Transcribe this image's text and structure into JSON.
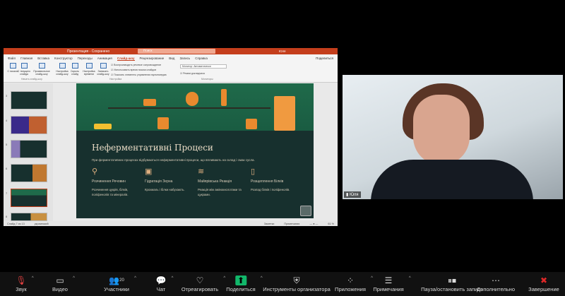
{
  "powerpoint": {
    "doc_title": "Презентация - Сохранено",
    "search_placeholder": "Поиск",
    "user": "Юля",
    "tabs": [
      "Файл",
      "Главная",
      "Вставка",
      "Конструктор",
      "Переходы",
      "Анимация",
      "Слайд-шоу",
      "Рецензирование",
      "Вид",
      "Запись",
      "Справка"
    ],
    "active_tab": "Слайд-шоу",
    "share": "Поделиться",
    "ribbon_buttons": [
      "С начала",
      "С текущего слайда",
      "Произвольное слайд-шоу",
      "Настройка слайд-шоу",
      "Скрыть слайд",
      "Настройка времени",
      "Записать слайд-шоу"
    ],
    "checkboxes": [
      "Воспроизводить речевое сопровождение",
      "Использовать время показа слайдов",
      "Показать элементы управления мультимедиа"
    ],
    "monitor_select": "Монитор: Автоматически",
    "presenter_view": "Режим докладчика",
    "groups": [
      "Начать слайд-шоу",
      "Настройка",
      "Мониторы"
    ],
    "thumb_numbers": [
      "3",
      "4",
      "5",
      "6",
      "7",
      "8"
    ],
    "current_slide": "7",
    "status": {
      "slide": "Слайд 7 из 13",
      "lang": "украинский",
      "notes": "Заметки",
      "comments": "Примечания",
      "zoom": "61 %"
    }
  },
  "slide": {
    "title": "Неферментативні Процеси",
    "subtitle": "При ферментативних процесах відбуваються неферментативні процеси, що впливають на склад і смак сусла.",
    "columns": [
      {
        "icon": "magnifier-icon",
        "glyph": "⚲",
        "heading": "Розчинення Речовин",
        "text": "Розчинення цукрів, білків, поліфенолів та мінералів."
      },
      {
        "icon": "book-icon",
        "glyph": "▣",
        "heading": "Гідратація Зерна",
        "text": "Крохмаль і білки набухають."
      },
      {
        "icon": "heat-icon",
        "glyph": "≋",
        "heading": "Майярівська Реакція",
        "text": "Реакція між амінокислотами та цукрами."
      },
      {
        "icon": "document-icon",
        "glyph": "▯",
        "heading": "Розщеплення Білків",
        "text": "Розпад білків і поліфенолів."
      }
    ]
  },
  "camera": {
    "label": "Юля"
  },
  "toolbar": {
    "items": [
      {
        "label": "Звук",
        "glyph": "🎙"
      },
      {
        "label": "Видео",
        "glyph": "▭"
      },
      {
        "label": "Участники",
        "glyph": "👥",
        "count": "20"
      },
      {
        "label": "Чат",
        "glyph": "💬"
      },
      {
        "label": "Отреагировать",
        "glyph": "♡"
      },
      {
        "label": "Поделиться",
        "glyph": "⬆"
      },
      {
        "label": "Инструменты организатора",
        "glyph": "⛨"
      },
      {
        "label": "Приложения",
        "glyph": "⁘"
      },
      {
        "label": "Примечания",
        "glyph": "☰"
      },
      {
        "label": "Пауза/остановить запись",
        "glyph": "⏸⏹"
      },
      {
        "label": "Дополнительно",
        "glyph": "⋯"
      },
      {
        "label": "Завершение",
        "glyph": "✖"
      }
    ],
    "colors": {
      "share": "#12b76a",
      "end": "#e02828"
    }
  }
}
